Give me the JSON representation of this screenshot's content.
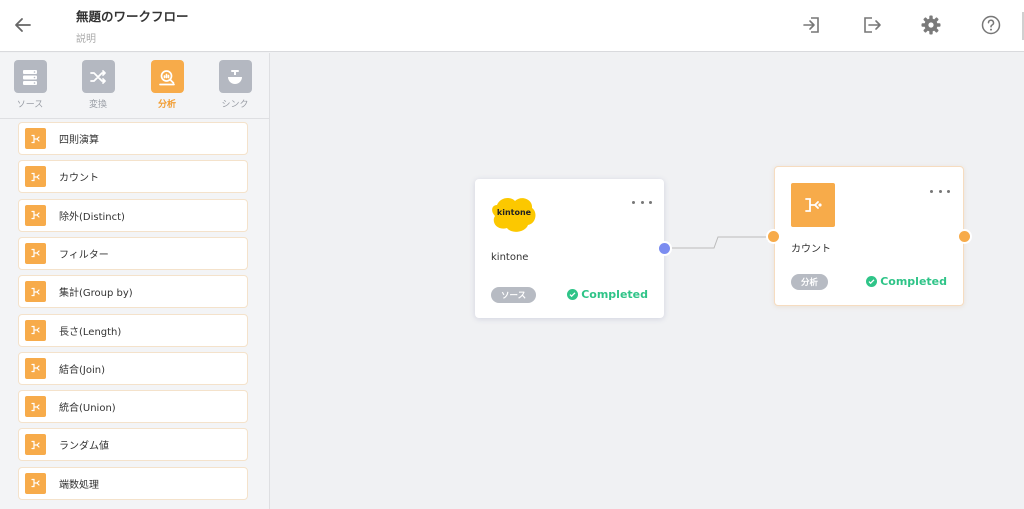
{
  "header": {
    "title": "無題のワークフロー",
    "description": "説明"
  },
  "sidebar": {
    "tabs": [
      {
        "label": "ソース",
        "icon": "database-icon"
      },
      {
        "label": "変換",
        "icon": "shuffle-icon"
      },
      {
        "label": "分析",
        "icon": "analyze-icon"
      },
      {
        "label": "シンク",
        "icon": "sink-icon"
      }
    ],
    "active_tab": "分析",
    "items": [
      {
        "label": "四則演算"
      },
      {
        "label": "カウント"
      },
      {
        "label": "除外(Distinct)"
      },
      {
        "label": "フィルター"
      },
      {
        "label": "集計(Group by)"
      },
      {
        "label": "長さ(Length)"
      },
      {
        "label": "結合(Join)"
      },
      {
        "label": "統合(Union)"
      },
      {
        "label": "ランダム値"
      },
      {
        "label": "端数処理"
      }
    ]
  },
  "nodes": {
    "source": {
      "logo_text": "kintone",
      "name": "kintone",
      "badge": "ソース",
      "status": "Completed"
    },
    "analysis": {
      "name": "カウント",
      "badge": "分析",
      "status": "Completed"
    }
  },
  "colors": {
    "accent": "#f7ab4a",
    "completed": "#2fc488",
    "port_output": "#7b8cf0",
    "badge": "#b7bbc3"
  }
}
